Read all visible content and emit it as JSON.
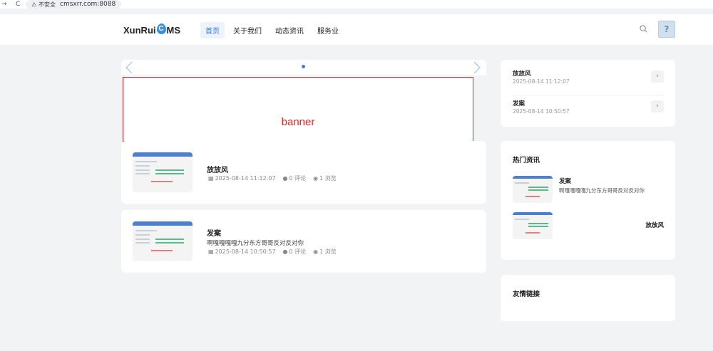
{
  "browser": {
    "security_label": "⚠ 不安全",
    "url": "cmsxrr.com:8088"
  },
  "header": {
    "logo_prefix": "XunRui",
    "logo_drop_letter": "C",
    "logo_suffix": "MS",
    "nav": [
      {
        "label": "首页",
        "active": true
      },
      {
        "label": "关于我们",
        "active": false
      },
      {
        "label": "动态资讯",
        "active": false
      },
      {
        "label": "服务业",
        "active": false
      }
    ],
    "avatar_glyph": "?"
  },
  "banner": {
    "text": "banner"
  },
  "articles": [
    {
      "title": "放放风",
      "description": "",
      "date": "2025-08-14 11:12:07",
      "comments": "0 评论",
      "views": "1 浏览"
    },
    {
      "title": "发案",
      "description": "啊嘎嘎嘎嘎九分东方哥哥反对反对你",
      "date": "2025-08-14 10:50:57",
      "comments": "0 评论",
      "views": "1 浏览"
    }
  ],
  "recent": [
    {
      "title": "放放风",
      "date": "2025-08-14 11:12:07"
    },
    {
      "title": "发案",
      "date": "2025-08-14 10:50:57"
    }
  ],
  "hot": {
    "title": "热门资讯",
    "items": [
      {
        "title": "发案",
        "description": "啊嘎嘎嘎嘎九分东方哥哥反对反对你"
      },
      {
        "title": "放放风",
        "description": ""
      }
    ]
  },
  "links": {
    "title": "友情链接"
  },
  "colors": {
    "accent": "#2f7ae5",
    "banner_red": "#e0261d",
    "background": "#f2f3f5"
  }
}
